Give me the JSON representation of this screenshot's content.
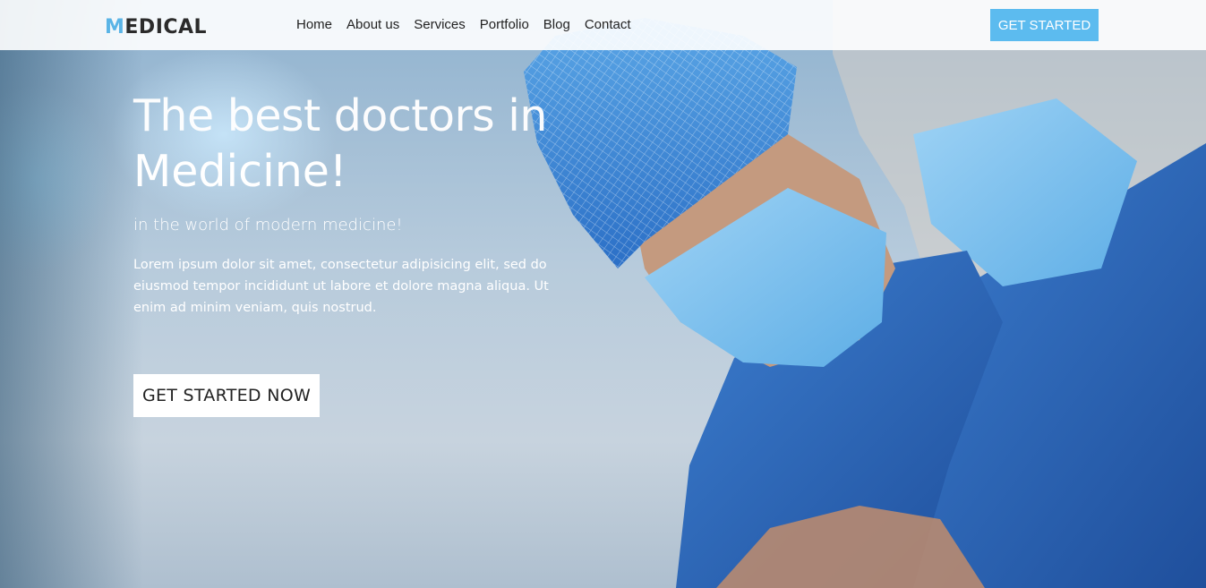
{
  "brand": {
    "first_letter": "M",
    "rest": "EDICAL"
  },
  "nav": {
    "items": [
      {
        "label": "Home"
      },
      {
        "label": "About us"
      },
      {
        "label": "Services"
      },
      {
        "label": "Portfolio"
      },
      {
        "label": "Blog"
      },
      {
        "label": "Contact"
      }
    ],
    "cta_label": "GET STARTED"
  },
  "hero": {
    "title_line1": "The best doctors in",
    "title_line2": "Medicine!",
    "subtitle": "in the world of modern medicine!",
    "description": "Lorem ipsum dolor sit amet, consectetur adipisicing elit, sed do eiusmod tempor incididunt ut labore et dolore magna aliqua. Ut enim ad minim veniam, quis nostrud.",
    "cta_label": "GET STARTED NOW"
  },
  "colors": {
    "accent": "#5cbbef",
    "scrubs": "#2a64b8",
    "mask": "#74b8e6"
  }
}
